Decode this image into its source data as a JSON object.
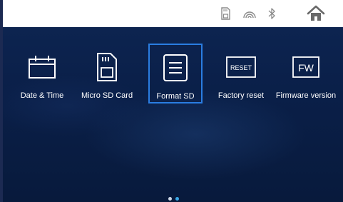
{
  "status_bar": {
    "icons": [
      "sd-card-icon",
      "wifi-signal-icon",
      "bluetooth-icon"
    ],
    "home_icon": "home-icon"
  },
  "menu": {
    "items": [
      {
        "label": "Date & Time",
        "icon": "calendar-icon"
      },
      {
        "label": "Micro SD Card",
        "icon": "sd-card-icon"
      },
      {
        "label": "Format SD",
        "icon": "list-icon",
        "selected": true
      },
      {
        "label": "Factory reset",
        "icon": "reset-icon",
        "icon_text": "RESET"
      },
      {
        "label": "Firmware version",
        "icon": "firmware-icon",
        "icon_text": "FW"
      }
    ]
  },
  "pager": {
    "current_page": 2,
    "total_pages": 2
  },
  "colors": {
    "background": "#0a1f48",
    "selection": "#2a7de1",
    "pager_active": "#3aa8e8",
    "pager_inactive": "#cfd8e8"
  }
}
